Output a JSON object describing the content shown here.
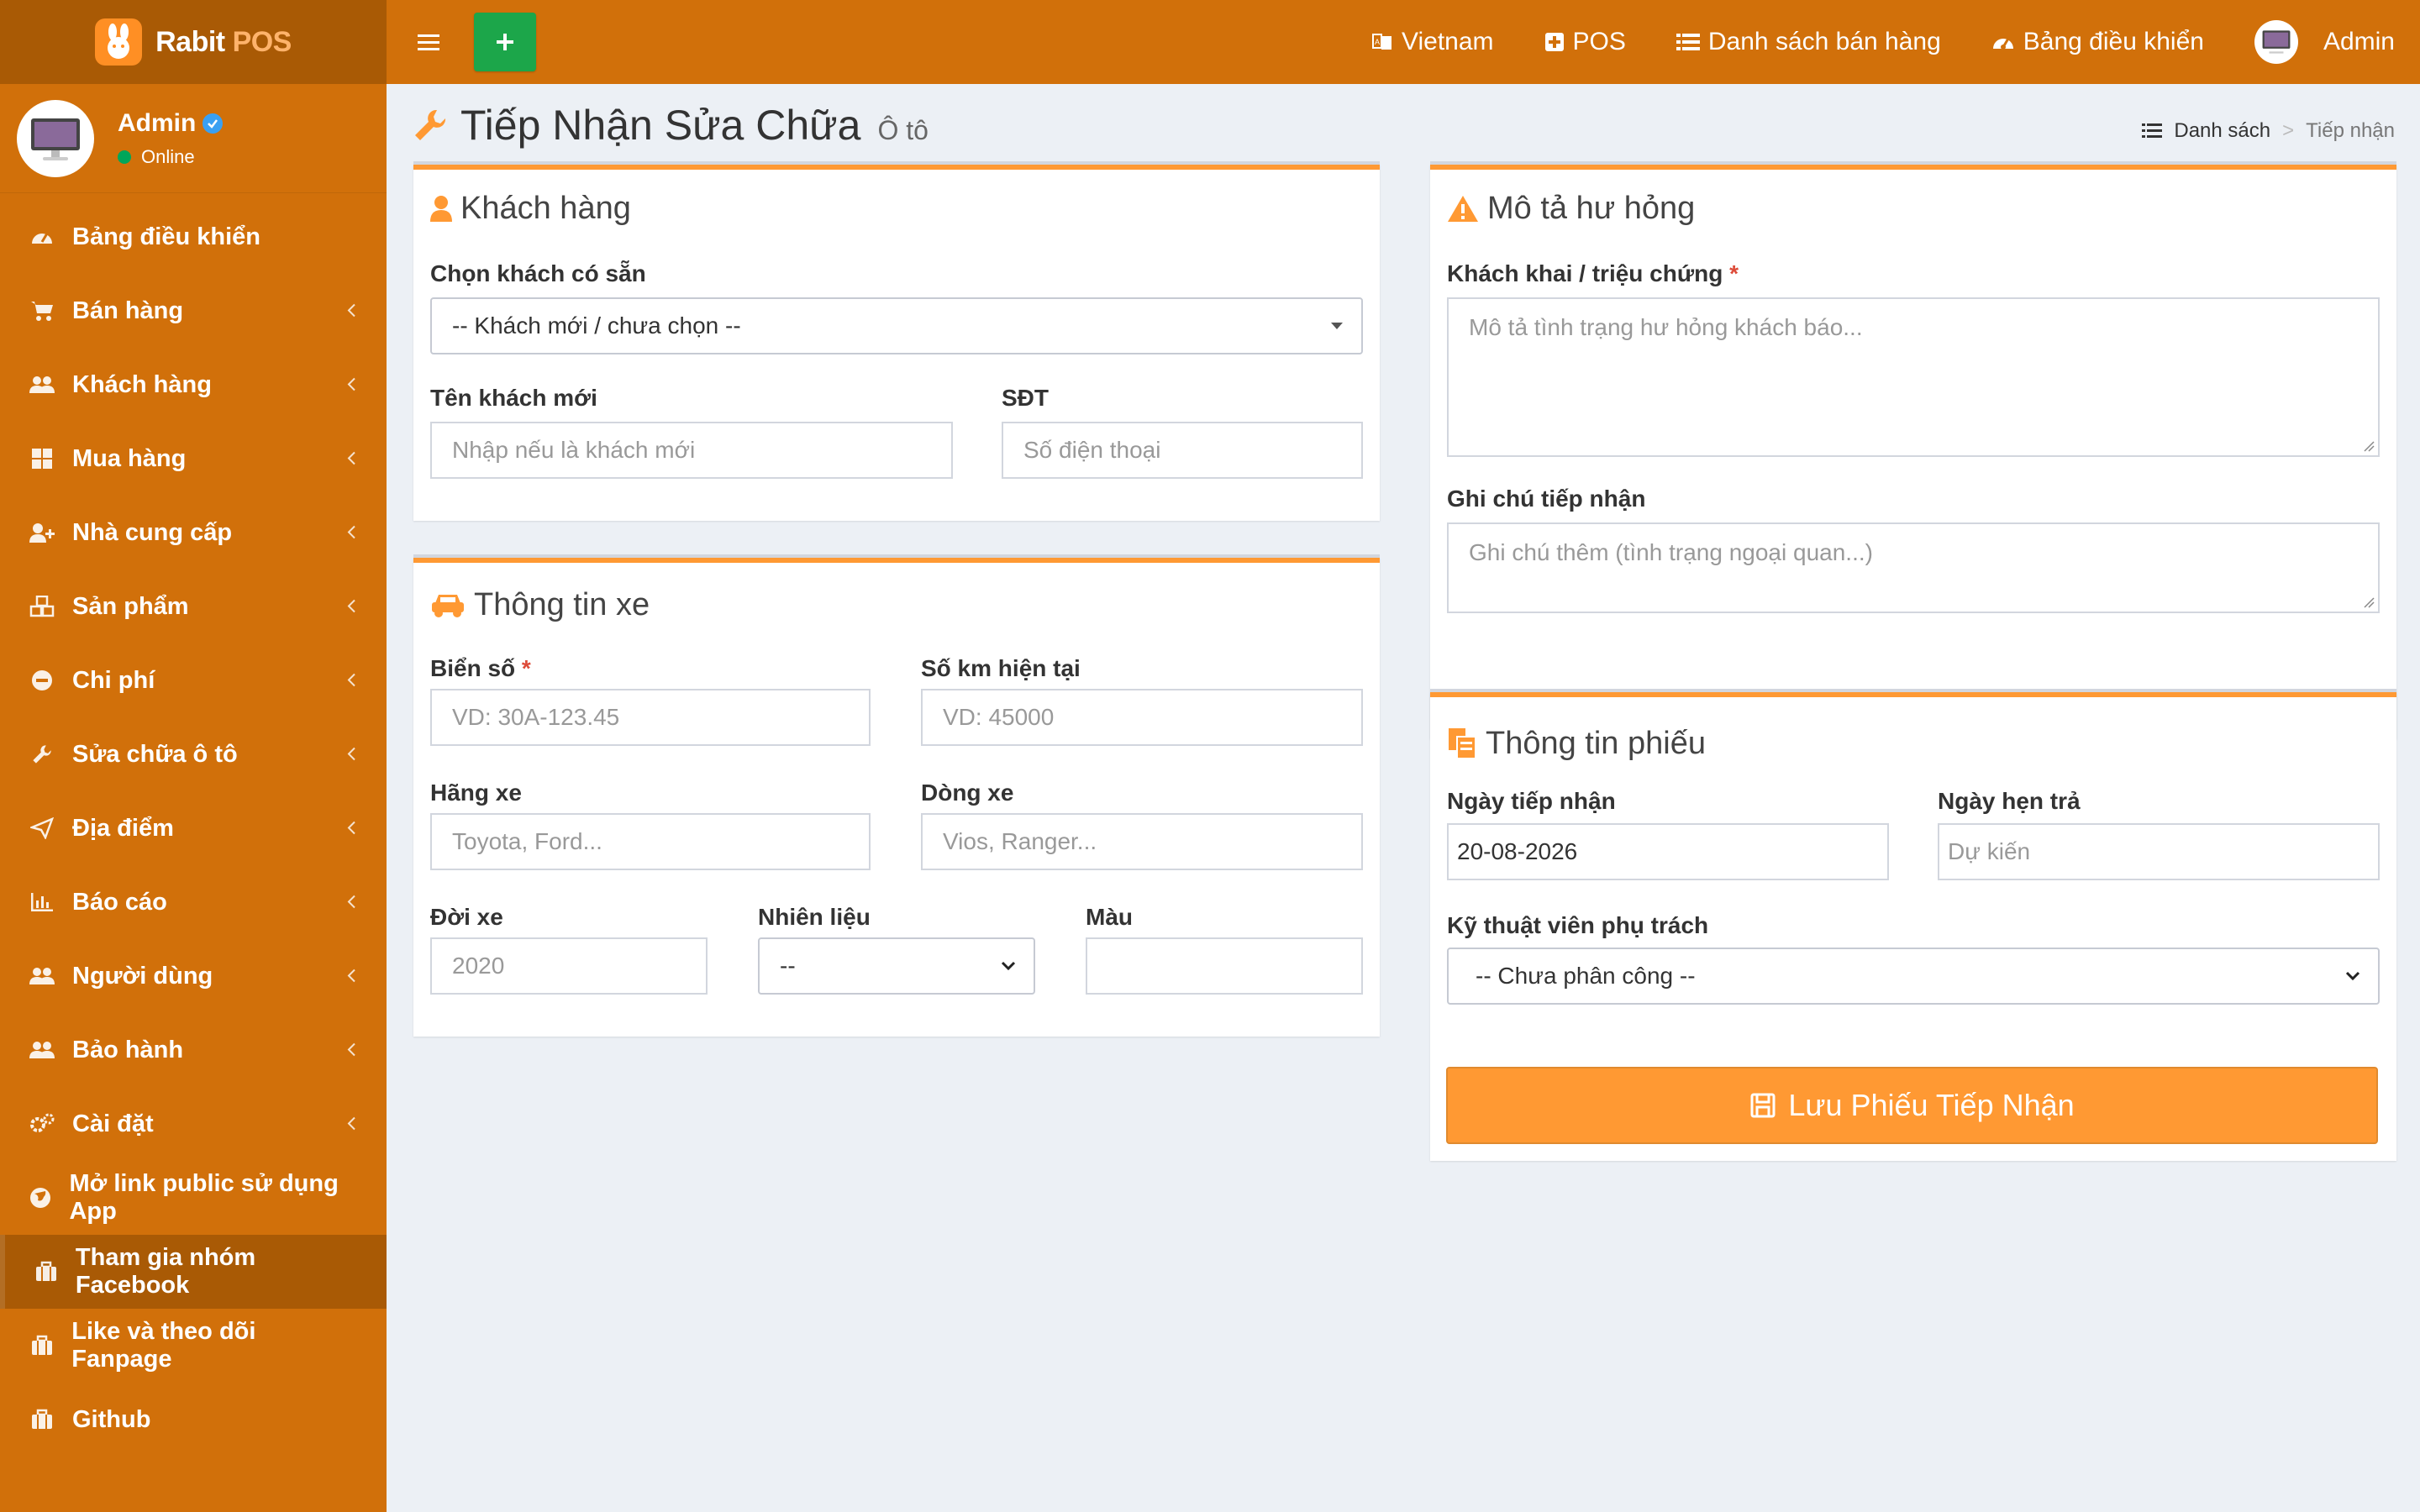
{
  "app": {
    "brand": "Rabit",
    "brand_suffix": "POS"
  },
  "sidebar": {
    "user": {
      "name": "Admin",
      "status": "Online"
    },
    "items": [
      {
        "label": "Bảng điều khiển",
        "icon": "dashboard-icon",
        "has_children": false
      },
      {
        "label": "Bán hàng",
        "icon": "cart-icon",
        "has_children": true
      },
      {
        "label": "Khách hàng",
        "icon": "users-icon",
        "has_children": true
      },
      {
        "label": "Mua hàng",
        "icon": "grid-icon",
        "has_children": true
      },
      {
        "label": "Nhà cung cấp",
        "icon": "user-plus-icon",
        "has_children": true
      },
      {
        "label": "Sản phẩm",
        "icon": "cubes-icon",
        "has_children": true
      },
      {
        "label": "Chi phí",
        "icon": "minus-circle-icon",
        "has_children": true
      },
      {
        "label": "Sửa chữa ô tô",
        "icon": "wrench-icon",
        "has_children": true
      },
      {
        "label": "Địa điểm",
        "icon": "send-icon",
        "has_children": true
      },
      {
        "label": "Báo cáo",
        "icon": "bar-chart-icon",
        "has_children": true
      },
      {
        "label": "Người dùng",
        "icon": "users-icon",
        "has_children": true
      },
      {
        "label": "Bảo hành",
        "icon": "users-icon",
        "has_children": true
      },
      {
        "label": "Cài đặt",
        "icon": "gears-icon",
        "has_children": true
      },
      {
        "label": "Mở link public sử dụng App",
        "icon": "globe-icon",
        "has_children": false
      },
      {
        "label": "Tham gia nhóm Facebook",
        "icon": "briefcase-icon",
        "has_children": false,
        "active": true
      },
      {
        "label": "Like và theo dõi Fanpage",
        "icon": "briefcase-icon",
        "has_children": false
      },
      {
        "label": "Github",
        "icon": "briefcase-icon",
        "has_children": false
      }
    ]
  },
  "header": {
    "nav": [
      {
        "label": "Vietnam",
        "icon": "language-icon"
      },
      {
        "label": "POS",
        "icon": "plus-square-icon"
      },
      {
        "label": "Danh sách bán hàng",
        "icon": "list-icon"
      },
      {
        "label": "Bảng điều khiển",
        "icon": "dashboard-icon"
      }
    ],
    "user_label": "Admin"
  },
  "page": {
    "title": "Tiếp Nhận Sửa Chữa",
    "subtitle": "Ô tô",
    "breadcrumb": {
      "list": "Danh sách",
      "sep": ">",
      "current": "Tiếp nhận"
    }
  },
  "customer": {
    "title": "Khách hàng",
    "choose_label": "Chọn khách có sẵn",
    "choose_value": "-- Khách mới / chưa chọn --",
    "name_label": "Tên khách mới",
    "name_placeholder": "Nhập nếu là khách mới",
    "phone_label": "SĐT",
    "phone_placeholder": "Số điện thoại"
  },
  "vehicle": {
    "title": "Thông tin xe",
    "plate_label": "Biển số",
    "plate_placeholder": "VD: 30A-123.45",
    "km_label": "Số km hiện tại",
    "km_placeholder": "VD: 45000",
    "brand_label": "Hãng xe",
    "brand_placeholder": "Toyota, Ford...",
    "model_label": "Dòng xe",
    "model_placeholder": "Vios, Ranger...",
    "year_label": "Đời xe",
    "year_placeholder": "2020",
    "fuel_label": "Nhiên liệu",
    "fuel_value": "--",
    "color_label": "Màu",
    "color_value": ""
  },
  "damage": {
    "title": "Mô tả hư hỏng",
    "symptom_label": "Khách khai / triệu chứng",
    "symptom_placeholder": "Mô tả tình trạng hư hỏng khách báo...",
    "note_label": "Ghi chú tiếp nhận",
    "note_placeholder": "Ghi chú thêm (tình trạng ngoại quan...)"
  },
  "ticket": {
    "title": "Thông tin phiếu",
    "received_label": "Ngày tiếp nhận",
    "received_value": "20-08-2026",
    "return_label": "Ngày hẹn trả",
    "return_placeholder": "Dự kiến",
    "tech_label": "Kỹ thuật viên phụ trách",
    "tech_value": "-- Chưa phân công --",
    "save_label": "Lưu Phiếu Tiếp Nhận"
  },
  "required_mark": "*",
  "colors": {
    "primary": "#d1700a",
    "dark": "#a95a05",
    "accent": "#ff9933",
    "add": "#1ca64a"
  }
}
